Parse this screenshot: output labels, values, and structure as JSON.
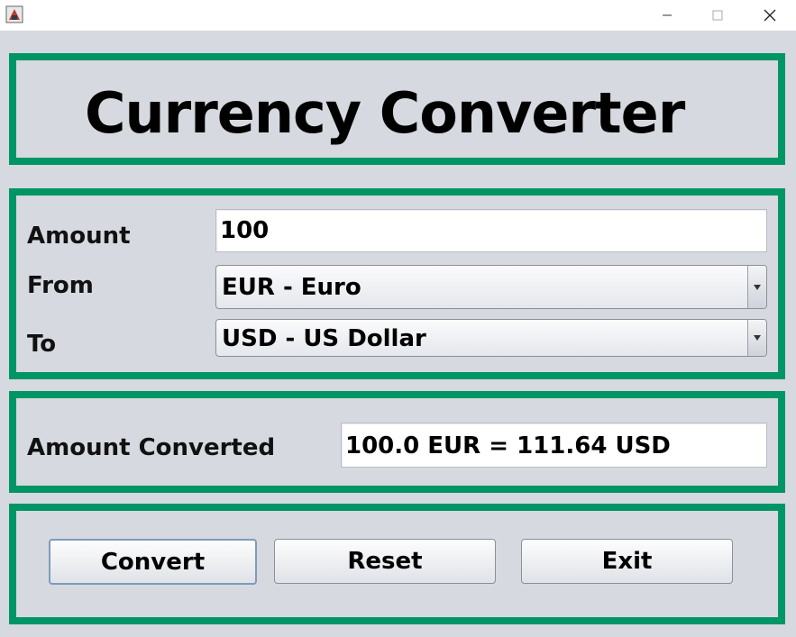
{
  "window": {
    "title_icon": "java-app-icon",
    "controls": {
      "minimize": "minimize-icon",
      "maximize": "maximize-icon",
      "close": "close-icon"
    }
  },
  "header": {
    "title": "Currency Converter"
  },
  "form": {
    "amount_label": "Amount",
    "amount_value": "100",
    "from_label": "From",
    "from_value": "EUR - Euro",
    "to_label": "To",
    "to_value": "USD - US Dollar"
  },
  "result": {
    "label": "Amount Converted",
    "value": "100.0 EUR = 111.64 USD"
  },
  "buttons": {
    "convert": "Convert",
    "reset": "Reset",
    "exit": "Exit"
  },
  "colors": {
    "panel_border": "#009564",
    "background": "#d6d9e0"
  }
}
